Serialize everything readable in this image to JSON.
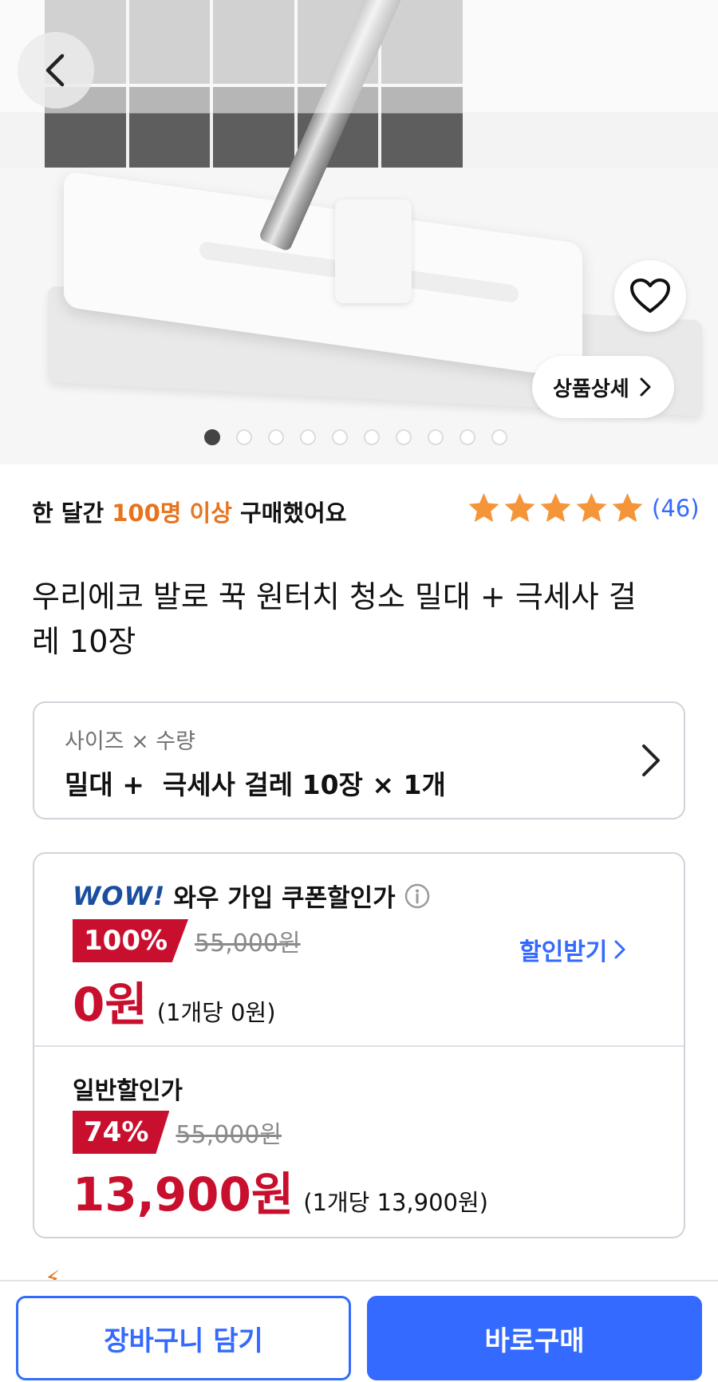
{
  "hero": {
    "detail_label": "상품상세",
    "slide_count": 10,
    "active_slide": 1
  },
  "social": {
    "prefix": "한 달간 ",
    "highlight": "100명 이상",
    "suffix": " 구매했어요",
    "rating": 5,
    "review_count": "(46)"
  },
  "product": {
    "title": "우리에코 발로 꾹 원터치 청소 밀대 + 극세사 걸레 10장"
  },
  "option": {
    "label": "사이즈 × 수량",
    "value": "밀대 +  극세사 걸레 10장 × 1개"
  },
  "wow_price": {
    "logo": "WOW!",
    "label": "와우 가입 쿠폰할인가",
    "discount": "100%",
    "original": "55,000원",
    "final": "0원",
    "per_unit": "(1개당 0원)",
    "coupon_link": "할인받기"
  },
  "normal_price": {
    "label": "일반할인가",
    "discount": "74%",
    "original": "55,000원",
    "final": "13,900원",
    "per_unit": "(1개당 13,900원)"
  },
  "bottom": {
    "cart_label": "장바구니 담기",
    "buy_label": "바로구매"
  },
  "colors": {
    "accent_blue": "#346aff",
    "sale_red": "#c8102e",
    "highlight_orange": "#e8731d",
    "star_orange": "#f5953a"
  }
}
